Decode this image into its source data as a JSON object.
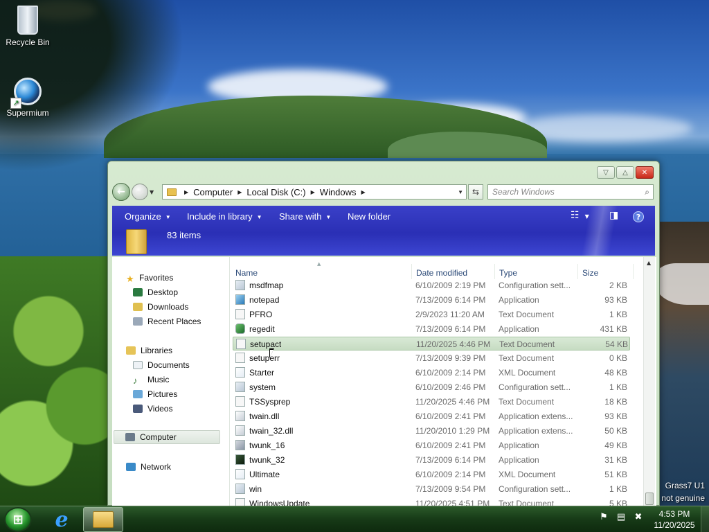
{
  "desktop": {
    "icons": [
      {
        "label": "Recycle Bin",
        "icon": "recycle-bin-icon"
      },
      {
        "label": "Supermium",
        "icon": "supermium-icon"
      }
    ],
    "watermark": {
      "line1": "Grass7 U1",
      "line2": "not genuine"
    }
  },
  "window": {
    "caption_buttons": {
      "minimize": "▽",
      "maximize": "△",
      "close": "✕"
    },
    "address": {
      "breadcrumbs": [
        "Computer",
        "Local Disk (C:)",
        "Windows"
      ]
    },
    "search": {
      "placeholder": "Search Windows"
    },
    "toolbar": {
      "organize": "Organize",
      "include_in_library": "Include in library",
      "share_with": "Share with",
      "new_folder": "New folder",
      "item_count": "83 items"
    },
    "nav_pane": {
      "favorites": "Favorites",
      "favorites_items": [
        "Desktop",
        "Downloads",
        "Recent Places"
      ],
      "libraries": "Libraries",
      "libraries_items": [
        "Documents",
        "Music",
        "Pictures",
        "Videos"
      ],
      "computer": "Computer",
      "network": "Network"
    },
    "columns": {
      "name": "Name",
      "date": "Date modified",
      "type": "Type",
      "size": "Size"
    },
    "files": [
      {
        "name": "msdfmap",
        "date": "6/10/2009 2:19 PM",
        "type": "Configuration sett...",
        "size": "2 KB",
        "icon": "cfg"
      },
      {
        "name": "notepad",
        "date": "7/13/2009 6:14 PM",
        "type": "Application",
        "size": "93 KB",
        "icon": "notepad"
      },
      {
        "name": "PFRO",
        "date": "2/9/2023 11:20 AM",
        "type": "Text Document",
        "size": "1 KB",
        "icon": "txt"
      },
      {
        "name": "regedit",
        "date": "7/13/2009 6:14 PM",
        "type": "Application",
        "size": "431 KB",
        "icon": "reg"
      },
      {
        "name": "setupact",
        "date": "11/20/2025 4:46 PM",
        "type": "Text Document",
        "size": "54 KB",
        "icon": "txt",
        "selected": true
      },
      {
        "name": "setuperr",
        "date": "7/13/2009 9:39 PM",
        "type": "Text Document",
        "size": "0 KB",
        "icon": "txt"
      },
      {
        "name": "Starter",
        "date": "6/10/2009 2:14 PM",
        "type": "XML Document",
        "size": "48 KB",
        "icon": "xml"
      },
      {
        "name": "system",
        "date": "6/10/2009 2:46 PM",
        "type": "Configuration sett...",
        "size": "1 KB",
        "icon": "cfg"
      },
      {
        "name": "TSSysprep",
        "date": "11/20/2025 4:46 PM",
        "type": "Text Document",
        "size": "18 KB",
        "icon": "txt"
      },
      {
        "name": "twain.dll",
        "date": "6/10/2009 2:41 PM",
        "type": "Application extens...",
        "size": "93 KB",
        "icon": "dll"
      },
      {
        "name": "twain_32.dll",
        "date": "11/20/2010 1:29 PM",
        "type": "Application extens...",
        "size": "50 KB",
        "icon": "dll"
      },
      {
        "name": "twunk_16",
        "date": "6/10/2009 2:41 PM",
        "type": "Application",
        "size": "49 KB",
        "icon": "app"
      },
      {
        "name": "twunk_32",
        "date": "7/13/2009 6:14 PM",
        "type": "Application",
        "size": "31 KB",
        "icon": "twunk"
      },
      {
        "name": "Ultimate",
        "date": "6/10/2009 2:14 PM",
        "type": "XML Document",
        "size": "51 KB",
        "icon": "xml"
      },
      {
        "name": "win",
        "date": "7/13/2009 9:54 PM",
        "type": "Configuration sett...",
        "size": "1 KB",
        "icon": "cfg"
      },
      {
        "name": "WindowsUpdate",
        "date": "11/20/2025 4:51 PM",
        "type": "Text Document",
        "size": "5 KB",
        "icon": "txt"
      }
    ]
  },
  "taskbar": {
    "clock_time": "4:53 PM",
    "clock_date": "11/20/2025",
    "tray_icons": [
      "flag-icon",
      "network-icon",
      "volume-muted-icon"
    ]
  },
  "colors": {
    "toolbar_blue": "#2a2fb5",
    "window_frame": "#d7ead1",
    "taskbar": "#173a17",
    "selection": "#c6dcc2"
  }
}
